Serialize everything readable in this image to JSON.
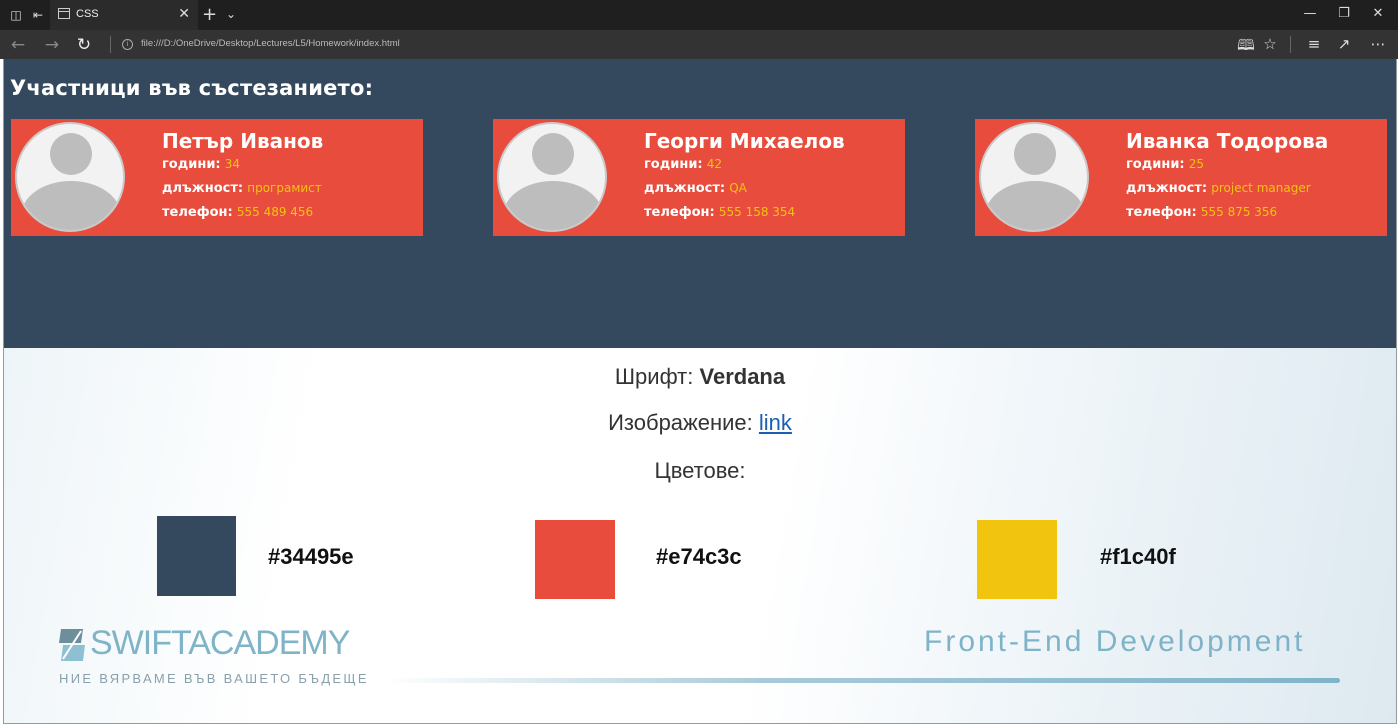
{
  "browser": {
    "tab_title": "CSS",
    "url": "file:///D:/OneDrive/Desktop/Lectures/L5/Homework/index.html"
  },
  "hero": {
    "title": "Участници във състезанието:",
    "participants": [
      {
        "name": "Петър Иванов",
        "age_label": "години:",
        "age": "34",
        "position_label": "длъжност:",
        "position": "програмист",
        "phone_label": "телефон:",
        "phone": "555 489 456"
      },
      {
        "name": "Георги Михаелов",
        "age_label": "години:",
        "age": "42",
        "position_label": "длъжност:",
        "position": "QA",
        "phone_label": "телефон:",
        "phone": "555 158 354"
      },
      {
        "name": "Иванка Тодорова",
        "age_label": "години:",
        "age": "25",
        "position_label": "длъжност:",
        "position": "project manager",
        "phone_label": "телефон:",
        "phone": "555 875 356"
      }
    ]
  },
  "info": {
    "font_label": "Шрифт:",
    "font_value": "Verdana",
    "image_label": "Изображение:",
    "image_link": "link",
    "colors_label": "Цветове:",
    "colors": [
      {
        "hex": "#34495e",
        "label": "#34495e"
      },
      {
        "hex": "#e74c3c",
        "label": "#e74c3c"
      },
      {
        "hex": "#f1c40f",
        "label": "#f1c40f"
      }
    ]
  },
  "branding": {
    "logo_text": "SWIFTACADEMY",
    "logo_tagline": "НИЕ ВЯРВАМЕ ВЪВ ВАШЕТО БЪДЕЩЕ",
    "course": "Front-End  Development"
  },
  "icons": [
    "tab-switcher-icon",
    "set-aside-tabs-icon",
    "page-icon",
    "close-icon",
    "plus-icon",
    "chevron-down-icon",
    "minimize-icon",
    "restore-icon",
    "back-icon",
    "forward-icon",
    "refresh-icon",
    "info-icon",
    "reading-view-icon",
    "star-icon",
    "favorites-hub-icon",
    "share-icon",
    "more-icon"
  ]
}
